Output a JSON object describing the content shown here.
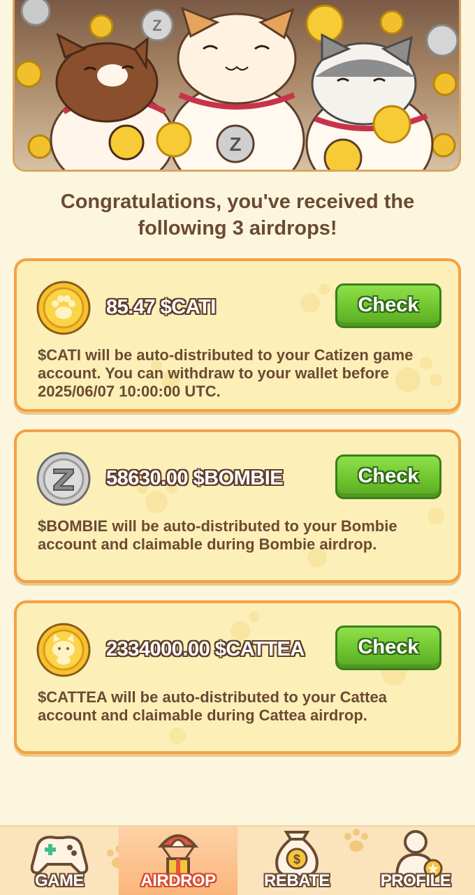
{
  "headline": "Congratulations, you've received the following 3 airdrops!",
  "airdrops": [
    {
      "amount": "85.47 $CATI",
      "coin_icon": "cati-paw-coin-icon",
      "check_label": "Check",
      "description": "$CATI will be auto-distributed to your Catizen game account. You can withdraw to your wallet before 2025/06/07 10:00:00 UTC."
    },
    {
      "amount": "58630.00 $BOMBIE",
      "coin_icon": "bombie-z-coin-icon",
      "check_label": "Check",
      "description": "$BOMBIE will be auto-distributed to your Bombie account and claimable during Bombie airdrop."
    },
    {
      "amount": "2334000.00 $CATTEA",
      "coin_icon": "cattea-cat-coin-icon",
      "check_label": "Check",
      "description": "$CATTEA will be auto-distributed to your Cattea account and claimable during Cattea airdrop."
    }
  ],
  "nav": {
    "items": [
      {
        "label": "GAME",
        "icon": "gamepad-icon",
        "active": false
      },
      {
        "label": "AIRDROP",
        "icon": "parachute-gift-icon",
        "active": true
      },
      {
        "label": "REBATE",
        "icon": "money-bag-icon",
        "active": false
      },
      {
        "label": "PROFILE",
        "icon": "person-icon",
        "active": false
      }
    ]
  },
  "colors": {
    "background": "#fdf6df",
    "card_border": "#f5a043",
    "card_fill": "#fcefb8",
    "check_green": "#6cc22c",
    "text_brown": "#6b4a33",
    "active_tab": "#fbb57b"
  }
}
